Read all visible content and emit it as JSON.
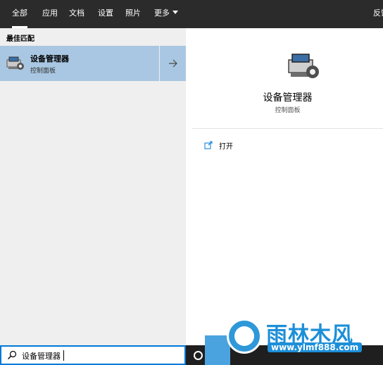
{
  "tabs": [
    {
      "label": "全部"
    },
    {
      "label": "应用"
    },
    {
      "label": "文档"
    },
    {
      "label": "设置"
    },
    {
      "label": "照片"
    },
    {
      "label": "更多"
    }
  ],
  "feedback_label": "反馈",
  "best_match": {
    "section_label": "最佳匹配",
    "title": "设备管理器",
    "subtitle": "控制面板",
    "icon": "device-manager-icon",
    "arrow_icon": "arrow-right-icon"
  },
  "preview": {
    "title": "设备管理器",
    "subtitle": "控制面板",
    "icon": "device-manager-icon",
    "action_open_label": "打开",
    "action_open_icon": "open-external-icon"
  },
  "search": {
    "value": "设备管理器",
    "icon": "search-icon"
  },
  "watermark": {
    "title": "雨林木风",
    "url": "www.ylmf888.com"
  },
  "colors": {
    "topbar": "#2b2b2b",
    "selected_result": "#a9c7e2",
    "search_border": "#0078d7",
    "watermark": "#1d8fd8"
  }
}
